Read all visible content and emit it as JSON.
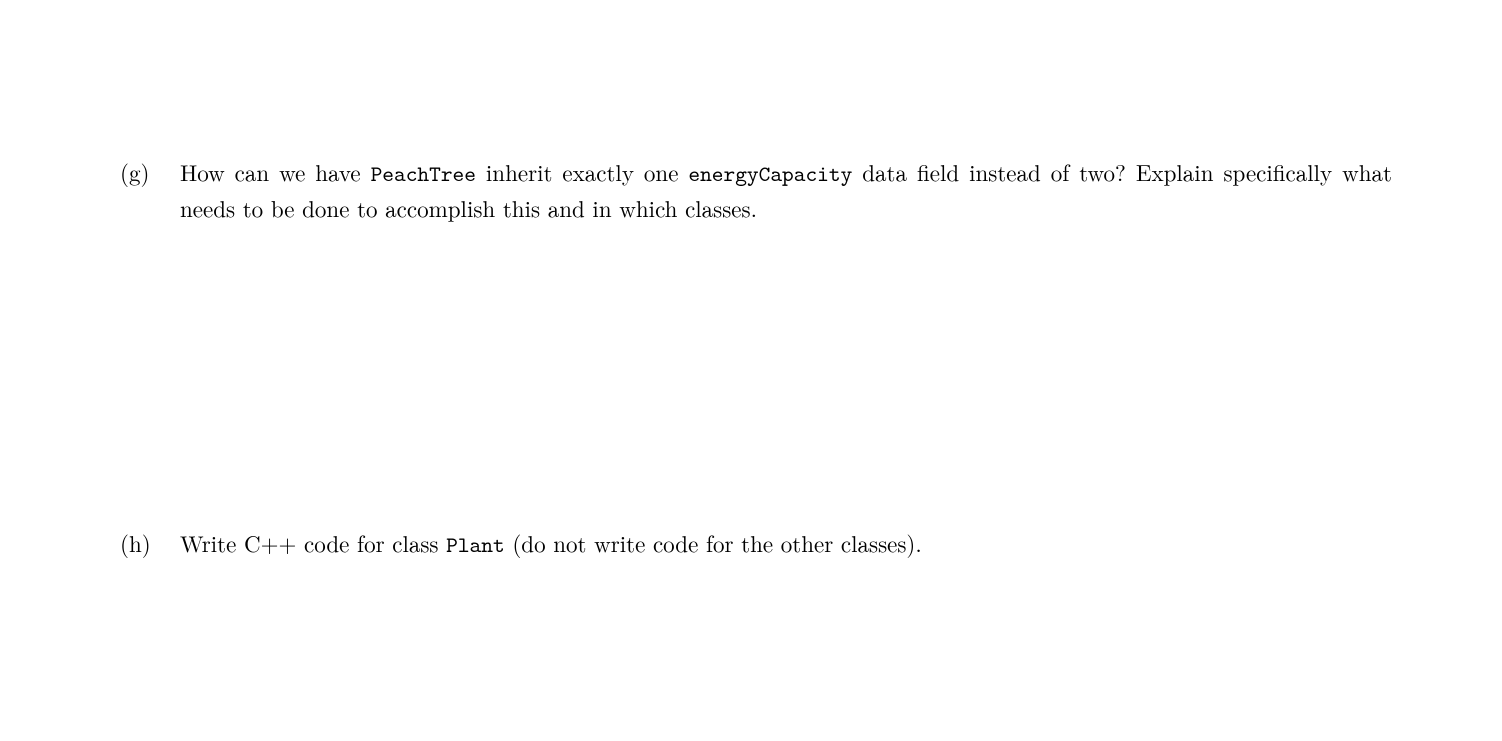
{
  "questions": {
    "g": {
      "label": "(g)",
      "text_before_code1": "How can we have ",
      "code1": "PeachTree",
      "text_between": " inherit exactly one ",
      "code2": "energyCapacity",
      "text_after": " data field instead of two?  Explain specifically what needs to be done to accomplish this and in which classes."
    },
    "h": {
      "label": "(h)",
      "text_before_code": "Write C++ code for class ",
      "code": "Plant",
      "text_after": " (do not write code for the other classes)."
    }
  }
}
